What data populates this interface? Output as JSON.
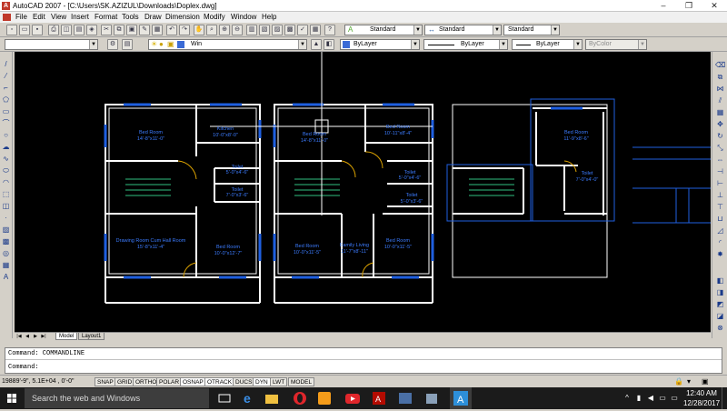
{
  "window": {
    "app_icon": "A",
    "title": "AutoCAD 2007 - [C:\\Users\\SK.AZIZUL\\Downloads\\Doplex.dwg]",
    "minimize": "–",
    "maximize": "❐",
    "close": "✕"
  },
  "menu": [
    "File",
    "Edit",
    "View",
    "Insert",
    "Format",
    "Tools",
    "Draw",
    "Dimension",
    "Modify",
    "Window",
    "Help"
  ],
  "toolbar": {
    "text_style": "Standard",
    "dim_style": "Standard",
    "table_style": "Standard",
    "layer": "Win",
    "color": "ByLayer",
    "linetype": "ByLayer",
    "lineweight": "ByLayer",
    "plotstyle": "ByColor"
  },
  "drawing": {
    "rooms": [
      "Bed Room",
      "14'-8\"x11'-0\"",
      "Kitchen",
      "10'-0\"x8'-0\"",
      "Toilet",
      "5'-0\"x4'-6\"",
      "Toilet",
      "7'-0\"x3'-6\"",
      "Drawing Room Cum Hall Room",
      "15'-8\"x11'-4\"",
      "Bed Room",
      "10'-0\"x12'-7\"",
      "Bed Room",
      "14'-8\"x11'-0\"",
      "Bed Room",
      "10'-11\"x8'-4\"",
      "Toilet",
      "5'-0\"x4'-6\"",
      "Toilet",
      "5'-0\"x3'-6\"",
      "Bed Room",
      "10'-0\"x11'-5\"",
      "Family Living",
      "11'-7\"x8'-11\"",
      "Bed Room",
      "10'-0\"x11'-5\"",
      "Bed Room",
      "11'-9\"x8'-6\"",
      "Toilet",
      "7'-0\"x4'-0\""
    ],
    "line_color": "#ffffff",
    "window_color": "#1f5fe0",
    "text_color": "#3c7cff",
    "door_color": "#d9a000"
  },
  "tabs": [
    "Model",
    "Layout1"
  ],
  "commandline": {
    "history": "Command: COMMANDLINE",
    "prompt": "Command:"
  },
  "status": {
    "coords": "19889'-9\",  5.1E+04 , 0'-0\"",
    "toggles": [
      "SNAP",
      "GRID",
      "ORTHO",
      "POLAR",
      "OSNAP",
      "OTRACK",
      "DUCS",
      "DYN",
      "LWT",
      "MODEL"
    ]
  },
  "taskbar": {
    "search_placeholder": "Search the web and Windows",
    "time": "12:40 AM",
    "date": "12/28/2017"
  }
}
